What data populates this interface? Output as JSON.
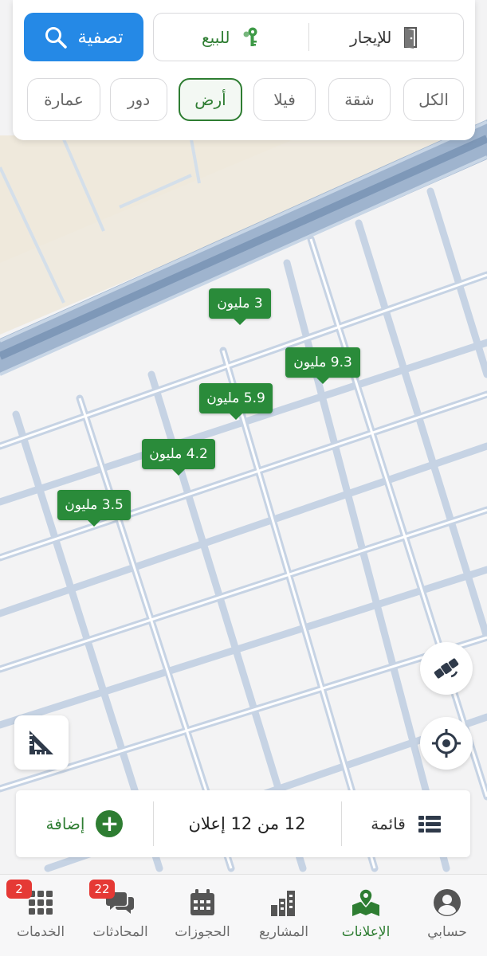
{
  "filter": {
    "filter_button_label": "تصفية",
    "purpose": {
      "rent_label": "للإيجار",
      "sale_label": "للبيع",
      "selected": "sale"
    },
    "types": [
      {
        "label": "الكل",
        "active": false
      },
      {
        "label": "شقة",
        "active": false
      },
      {
        "label": "فيلا",
        "active": false
      },
      {
        "label": "أرض",
        "active": true
      },
      {
        "label": "دور",
        "active": false
      },
      {
        "label": "عمارة",
        "active": false
      }
    ]
  },
  "markers": [
    {
      "label": "3 مليون"
    },
    {
      "label": "9.3 مليون"
    },
    {
      "label": "5.9 مليون"
    },
    {
      "label": "4.2 مليون"
    },
    {
      "label": "3.5 مليون"
    }
  ],
  "map_controls": {
    "satellite_icon": "satellite-icon",
    "locate_icon": "crosshair-icon",
    "measure_icon": "ruler-triangle-icon"
  },
  "action_bar": {
    "add_label": "إضافة",
    "count_label": "12 من 12 إعلان",
    "list_label": "قائمة"
  },
  "nav": {
    "items": [
      {
        "label": "الخدمات",
        "icon": "grid-icon",
        "badge": "2",
        "active": false
      },
      {
        "label": "المحادثات",
        "icon": "chat-icon",
        "badge": "22",
        "active": false
      },
      {
        "label": "الحجوزات",
        "icon": "calendar-icon",
        "badge": "",
        "active": false
      },
      {
        "label": "المشاريع",
        "icon": "buildings-icon",
        "badge": "",
        "active": false
      },
      {
        "label": "الإعلانات",
        "icon": "map-pin-icon",
        "badge": "",
        "active": true
      },
      {
        "label": "حسابي",
        "icon": "account-icon",
        "badge": "",
        "active": false
      }
    ]
  },
  "colors": {
    "accent_blue": "#2589e6",
    "accent_green": "#2e7d32",
    "marker_green": "#2a8b3a",
    "badge_red": "#e53935"
  }
}
